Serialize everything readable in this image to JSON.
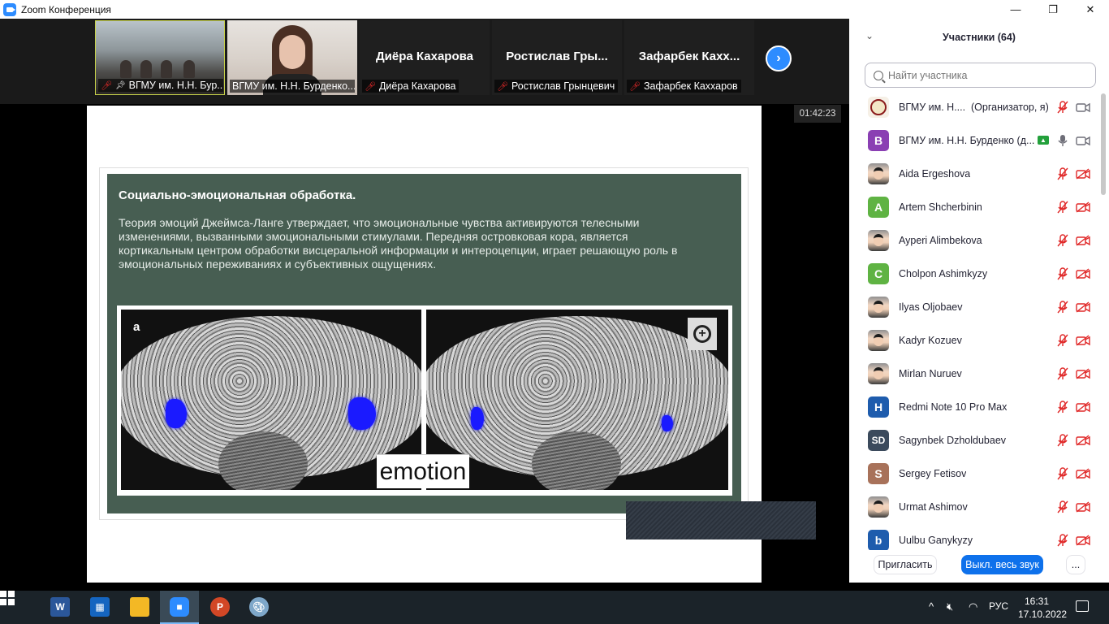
{
  "window": {
    "title": "Zoom Конференция",
    "controls": {
      "minimize": "—",
      "restore": "❐",
      "close": "✕"
    }
  },
  "strip": {
    "tiles": [
      {
        "label": "ВГМУ им. Н.Н. Бур...",
        "type": "video-room"
      },
      {
        "label": "ВГМУ им. Н.Н. Бурденко...",
        "type": "video-presenter"
      },
      {
        "label": "Диёра Кахарова",
        "name_center": "Диёра Кахарова"
      },
      {
        "label": "Ростислав Грынцевич",
        "name_center": "Ростислав Гры..."
      },
      {
        "label": "Зафарбек Каххаров",
        "name_center": "Зафарбек Кахх..."
      }
    ],
    "next_symbol": "›"
  },
  "meeting": {
    "timer": "01:42:23"
  },
  "slide": {
    "title": "Социально-эмоциональная обработка.",
    "body": "Теория эмоций Джеймса-Ланге утверждает, что эмоциональные чувства активируются телесными изменениями, вызванными эмоциональными стимулами. Передняя островковая кора, является кортикальным центром обработки висцеральной информации и интероцепции, играет решающую роль в эмоциональных переживаниях и субъективных ощущениях.",
    "figure_letter": "a",
    "figure_label": "emotion",
    "figure_zoom": "+"
  },
  "participants": {
    "header": "Участники (64)",
    "search_placeholder": "Найти участника",
    "list": [
      {
        "name": "ВГМУ им. Н....",
        "role": "(Организатор, я)",
        "avatar": "logo",
        "mic": "off",
        "cam": "on"
      },
      {
        "name": "ВГМУ им. Н.Н. Бурденко (д...",
        "avatar_letter": "В",
        "avatar_color": "#8a3fb3",
        "mic": "on",
        "cam": "on",
        "sharing": true
      },
      {
        "name": "Aida Ergeshova",
        "avatar": "photo",
        "mic": "off",
        "cam": "off"
      },
      {
        "name": "Artem Shcherbinin",
        "avatar_letter": "A",
        "avatar_color": "#5fb343",
        "mic": "off",
        "cam": "off"
      },
      {
        "name": "Ayperi Alimbekova",
        "avatar": "photo",
        "mic": "off",
        "cam": "off"
      },
      {
        "name": "Cholpon Ashimkyzy",
        "avatar_letter": "C",
        "avatar_color": "#5fb343",
        "mic": "off",
        "cam": "off"
      },
      {
        "name": "Ilyas Oljobaev",
        "avatar": "photo",
        "mic": "off",
        "cam": "off"
      },
      {
        "name": "Kadyr Kozuev",
        "avatar": "photo",
        "mic": "off",
        "cam": "off"
      },
      {
        "name": "Mirlan Nuruev",
        "avatar": "photo",
        "mic": "off",
        "cam": "off"
      },
      {
        "name": "Redmi Note 10 Pro Max",
        "avatar_letter": "H",
        "avatar_color": "#1e5cad",
        "mic": "off",
        "cam": "off"
      },
      {
        "name": "Sagynbek Dzholdubaev",
        "avatar_letter": "SD",
        "avatar_color": "#3b4a5c",
        "mic": "off",
        "cam": "off"
      },
      {
        "name": "Sergey Fetisov",
        "avatar_letter": "S",
        "avatar_color": "#a8725a",
        "mic": "off",
        "cam": "off"
      },
      {
        "name": "Urmat Ashimov",
        "avatar": "photo",
        "mic": "off",
        "cam": "off"
      },
      {
        "name": "Uulbu Ganykyzy",
        "avatar_letter": "b",
        "avatar_color": "#1e5cad",
        "mic": "off",
        "cam": "off"
      }
    ],
    "invite_label": "Пригласить",
    "mute_all_label": "Выкл. весь звук",
    "more_label": "..."
  },
  "taskbar": {
    "apps": [
      "windows-start",
      "word",
      "calculator-grid",
      "file-explorer",
      "zoom",
      "powerpoint",
      "paint"
    ],
    "tray": {
      "language": "РУС",
      "time": "16:31",
      "date": "17.10.2022"
    }
  },
  "colors": {
    "accent": "#2d8cff",
    "mute_red": "#e02828",
    "slide_green": "#475e52",
    "taskbar": "#1b2329"
  }
}
